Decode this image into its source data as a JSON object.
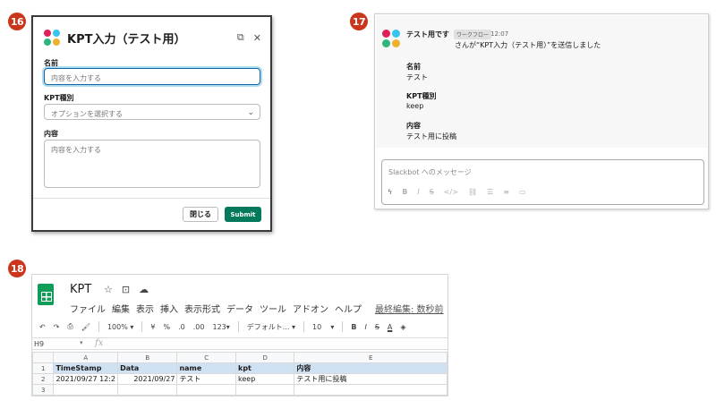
{
  "badges": [
    "16",
    "17",
    "18"
  ],
  "logo_colors": [
    "#e01e5a",
    "#36c5f0",
    "#2eb67d",
    "#ecb22e"
  ],
  "modal": {
    "title": "KPT入力（テスト用）",
    "name_label": "名前",
    "name_placeholder": "内容を入力する",
    "kpt_label": "KPT種別",
    "kpt_placeholder": "オプションを選択する",
    "content_label": "内容",
    "content_placeholder": "内容を入力する",
    "close_label": "閉じる",
    "submit_label": "Submit",
    "submit_color": "#007a5a",
    "external_icon": "external-link-icon",
    "close_icon": "close-icon"
  },
  "chat": {
    "sender": "テスト用です",
    "tag": "ワークフロー",
    "time": "12:07",
    "message": "さんが“KPT入力（テスト用）”を送信しました",
    "fields": [
      {
        "label": "名前",
        "value": "テスト"
      },
      {
        "label": "KPT種別",
        "value": "keep"
      },
      {
        "label": "内容",
        "value": "テスト用に投稿"
      }
    ],
    "composer_placeholder": "Slackbot へのメッセージ",
    "composer_tools": [
      "lightning-icon",
      "bold-icon",
      "italic-icon",
      "strikethrough-icon",
      "code-icon",
      "link-icon",
      "ordered-list-icon",
      "bullet-list-icon",
      "quote-icon"
    ]
  },
  "sheet": {
    "title": "KPT",
    "menu": [
      "ファイル",
      "編集",
      "表示",
      "挿入",
      "表示形式",
      "データ",
      "ツール",
      "アドオン",
      "ヘルプ"
    ],
    "last_edit": "最終編集: 数秒前",
    "toolbar": {
      "zoom": "100%",
      "currency": "¥",
      "percent": "%",
      "dec_less": ".0",
      "dec_more": ".00",
      "format": "123",
      "font": "デフォルト...",
      "font_size": "10",
      "bold": "B",
      "italic": "I",
      "strike": "S",
      "text_color": "A"
    },
    "cell_ref": "H9",
    "fx": "fx",
    "columns": [
      "A",
      "B",
      "C",
      "D",
      "E"
    ],
    "rows": [
      {
        "num": "1",
        "cells": [
          "TimeStamp",
          "Data",
          "name",
          "kpt",
          "内容"
        ]
      },
      {
        "num": "2",
        "cells": [
          "2021/09/27 12:2",
          "2021/09/27",
          "テスト",
          "keep",
          "テスト用に投稿"
        ]
      },
      {
        "num": "3",
        "cells": [
          "",
          "",
          "",
          "",
          ""
        ]
      }
    ],
    "header_fill": "#cfe2f3"
  }
}
